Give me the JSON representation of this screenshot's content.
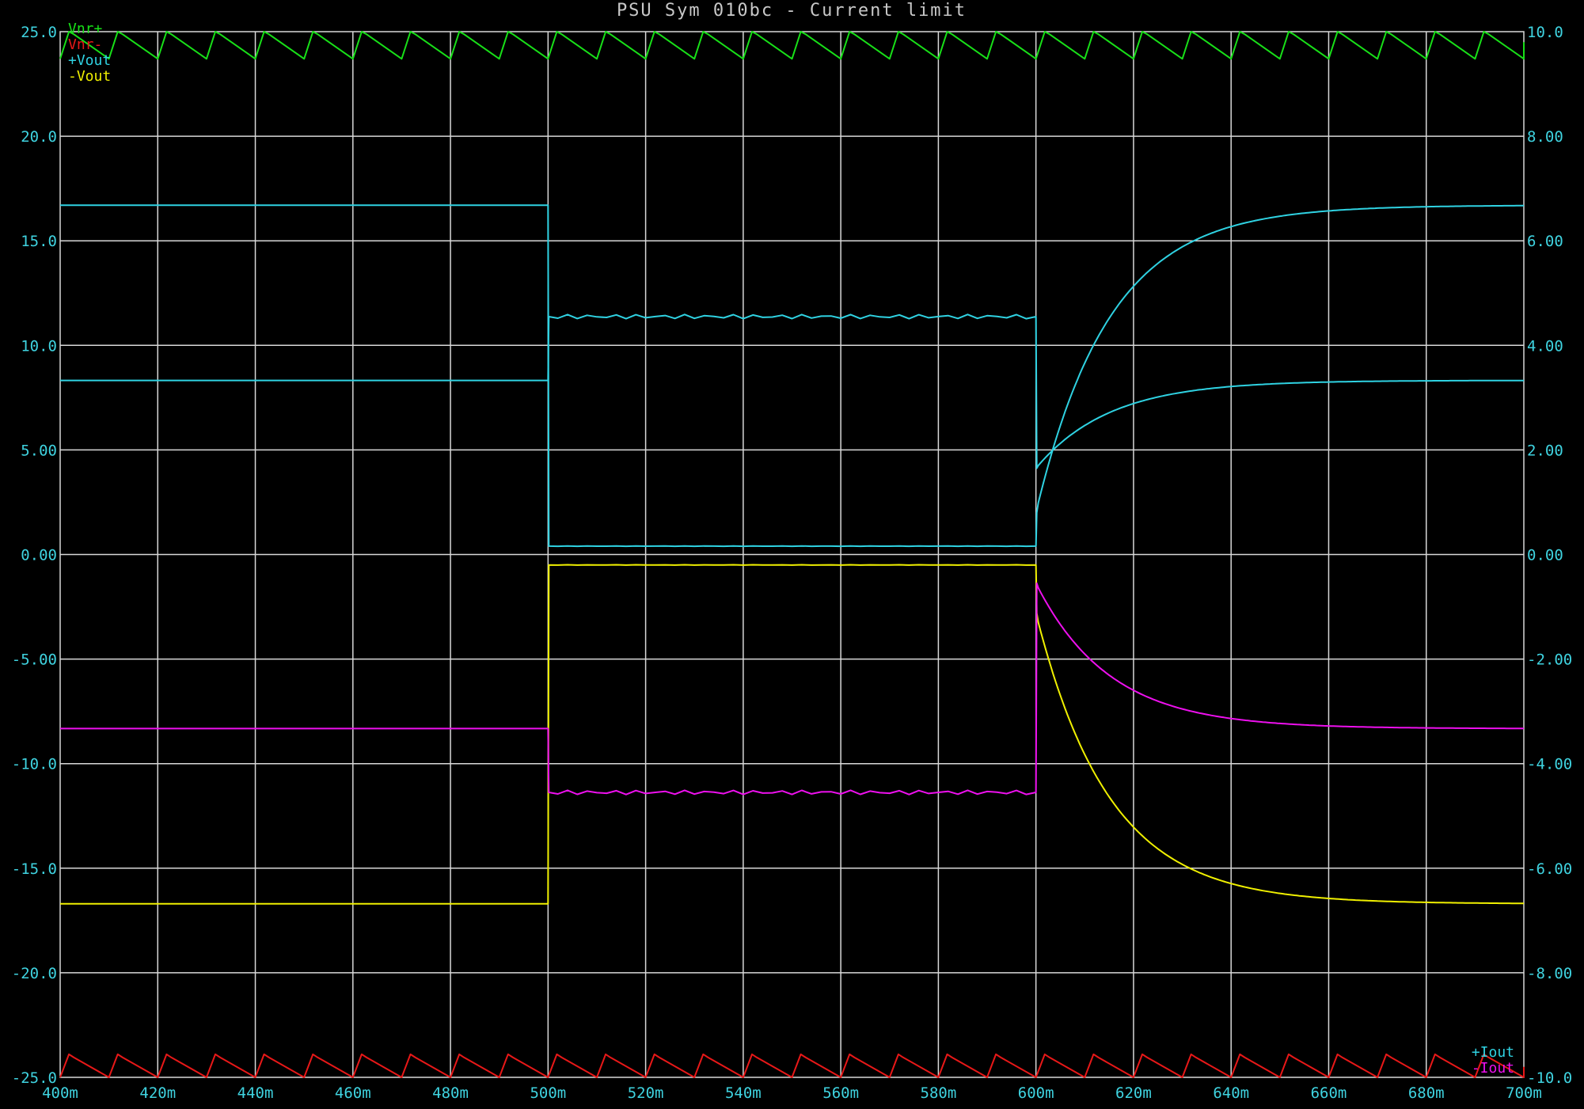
{
  "chart_data": {
    "type": "line",
    "title": "PSU Sym 010bc - Current limit",
    "x": {
      "min": 400,
      "max": 700,
      "ticks": [
        "400m",
        "420m",
        "440m",
        "460m",
        "480m",
        "500m",
        "520m",
        "540m",
        "560m",
        "580m",
        "600m",
        "620m",
        "640m",
        "660m",
        "680m",
        "700m"
      ]
    },
    "y_left": {
      "min": -25,
      "max": 25,
      "ticks": [
        "25.0",
        "20.0",
        "15.0",
        "10.0",
        "5.00",
        "0.00",
        "-5.00",
        "-10.0",
        "-15.0",
        "-20.0",
        "-25.0"
      ]
    },
    "y_right": {
      "min": -10,
      "max": 10,
      "ticks": [
        "10.0",
        "8.00",
        "6.00",
        "4.00",
        "2.00",
        "0.00",
        "-2.00",
        "-4.00",
        "-6.00",
        "-8.00",
        "-10.0"
      ]
    },
    "grid": true,
    "legend_top_left": [
      "Vnr+",
      "Vnr-",
      "+Vout",
      "-Vout"
    ],
    "legend_bottom_right": [
      "+Iout",
      "-Iout"
    ],
    "colors": {
      "background": "#000000",
      "grid": "#d8d8d8",
      "axis_text": "#3fd3e0",
      "title": "#c8c8c8",
      "vnr_plus": "#18e018",
      "vnr_minus": "#e81818",
      "vout_plus": "#2fd2e2",
      "vout_minus": "#f0f000",
      "iout_plus": "#2fd2e2",
      "iout_minus": "#ee10ee"
    },
    "series": [
      {
        "name": "Vnr+",
        "axis": "left",
        "shape": "ripple",
        "baseline": 24.5,
        "peak": 25.0,
        "trough": 23.7,
        "period_ms": 10,
        "color_key": "vnr_plus"
      },
      {
        "name": "Vnr-",
        "axis": "left",
        "shape": "ripple",
        "baseline": -24.5,
        "peak": -23.9,
        "trough": -25.0,
        "period_ms": 10,
        "color_key": "vnr_minus"
      },
      {
        "name": "+Vout",
        "axis": "left",
        "shape": "step_recover",
        "before": 16.7,
        "during": 0.4,
        "after": 16.7,
        "start": 2.0,
        "t_on": 500,
        "t_off": 600,
        "tau_ms": 15,
        "color_key": "vout_plus"
      },
      {
        "name": "-Vout",
        "axis": "left",
        "shape": "step_recover",
        "before": -16.7,
        "during": -0.5,
        "after": -16.7,
        "start": -2.8,
        "t_on": 500,
        "t_off": 600,
        "tau_ms": 15,
        "color_key": "vout_minus"
      },
      {
        "name": "+Iout",
        "axis": "right",
        "shape": "step_recover",
        "before": 3.33,
        "during": 4.55,
        "after": 3.33,
        "start": 1.65,
        "t_on": 500,
        "t_off": 600,
        "tau_ms": 15,
        "color_key": "iout_plus"
      },
      {
        "name": "-Iout",
        "axis": "right",
        "shape": "step_recover",
        "before": -3.33,
        "during": -4.55,
        "after": -3.33,
        "start": -0.55,
        "t_on": 500,
        "t_off": 600,
        "tau_ms": 15,
        "color_key": "iout_minus"
      }
    ]
  }
}
